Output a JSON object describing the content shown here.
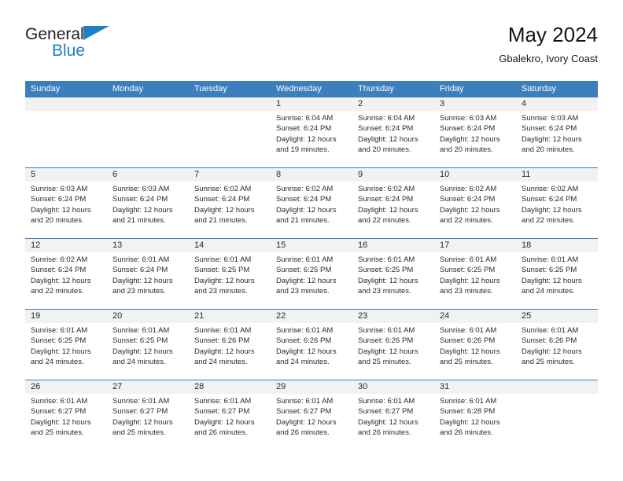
{
  "brand": {
    "name_part1": "General",
    "name_part2": "Blue",
    "logo_icon": "triangle-flag-icon",
    "color_dark": "#231f20",
    "color_blue": "#1f7fc4"
  },
  "header": {
    "title": "May 2024",
    "subtitle": "Gbalekro, Ivory Coast"
  },
  "theme": {
    "header_bg": "#3d7ebd",
    "day_band_bg": "#f2f2f2",
    "week_divider": "#3d7ebd"
  },
  "weekdays": [
    "Sunday",
    "Monday",
    "Tuesday",
    "Wednesday",
    "Thursday",
    "Friday",
    "Saturday"
  ],
  "weeks": [
    [
      {
        "day": "",
        "sunrise": "",
        "sunset": "",
        "daylight_line1": "",
        "daylight_line2": ""
      },
      {
        "day": "",
        "sunrise": "",
        "sunset": "",
        "daylight_line1": "",
        "daylight_line2": ""
      },
      {
        "day": "",
        "sunrise": "",
        "sunset": "",
        "daylight_line1": "",
        "daylight_line2": ""
      },
      {
        "day": "1",
        "sunrise": "Sunrise: 6:04 AM",
        "sunset": "Sunset: 6:24 PM",
        "daylight_line1": "Daylight: 12 hours",
        "daylight_line2": "and 19 minutes."
      },
      {
        "day": "2",
        "sunrise": "Sunrise: 6:04 AM",
        "sunset": "Sunset: 6:24 PM",
        "daylight_line1": "Daylight: 12 hours",
        "daylight_line2": "and 20 minutes."
      },
      {
        "day": "3",
        "sunrise": "Sunrise: 6:03 AM",
        "sunset": "Sunset: 6:24 PM",
        "daylight_line1": "Daylight: 12 hours",
        "daylight_line2": "and 20 minutes."
      },
      {
        "day": "4",
        "sunrise": "Sunrise: 6:03 AM",
        "sunset": "Sunset: 6:24 PM",
        "daylight_line1": "Daylight: 12 hours",
        "daylight_line2": "and 20 minutes."
      }
    ],
    [
      {
        "day": "5",
        "sunrise": "Sunrise: 6:03 AM",
        "sunset": "Sunset: 6:24 PM",
        "daylight_line1": "Daylight: 12 hours",
        "daylight_line2": "and 20 minutes."
      },
      {
        "day": "6",
        "sunrise": "Sunrise: 6:03 AM",
        "sunset": "Sunset: 6:24 PM",
        "daylight_line1": "Daylight: 12 hours",
        "daylight_line2": "and 21 minutes."
      },
      {
        "day": "7",
        "sunrise": "Sunrise: 6:02 AM",
        "sunset": "Sunset: 6:24 PM",
        "daylight_line1": "Daylight: 12 hours",
        "daylight_line2": "and 21 minutes."
      },
      {
        "day": "8",
        "sunrise": "Sunrise: 6:02 AM",
        "sunset": "Sunset: 6:24 PM",
        "daylight_line1": "Daylight: 12 hours",
        "daylight_line2": "and 21 minutes."
      },
      {
        "day": "9",
        "sunrise": "Sunrise: 6:02 AM",
        "sunset": "Sunset: 6:24 PM",
        "daylight_line1": "Daylight: 12 hours",
        "daylight_line2": "and 22 minutes."
      },
      {
        "day": "10",
        "sunrise": "Sunrise: 6:02 AM",
        "sunset": "Sunset: 6:24 PM",
        "daylight_line1": "Daylight: 12 hours",
        "daylight_line2": "and 22 minutes."
      },
      {
        "day": "11",
        "sunrise": "Sunrise: 6:02 AM",
        "sunset": "Sunset: 6:24 PM",
        "daylight_line1": "Daylight: 12 hours",
        "daylight_line2": "and 22 minutes."
      }
    ],
    [
      {
        "day": "12",
        "sunrise": "Sunrise: 6:02 AM",
        "sunset": "Sunset: 6:24 PM",
        "daylight_line1": "Daylight: 12 hours",
        "daylight_line2": "and 22 minutes."
      },
      {
        "day": "13",
        "sunrise": "Sunrise: 6:01 AM",
        "sunset": "Sunset: 6:24 PM",
        "daylight_line1": "Daylight: 12 hours",
        "daylight_line2": "and 23 minutes."
      },
      {
        "day": "14",
        "sunrise": "Sunrise: 6:01 AM",
        "sunset": "Sunset: 6:25 PM",
        "daylight_line1": "Daylight: 12 hours",
        "daylight_line2": "and 23 minutes."
      },
      {
        "day": "15",
        "sunrise": "Sunrise: 6:01 AM",
        "sunset": "Sunset: 6:25 PM",
        "daylight_line1": "Daylight: 12 hours",
        "daylight_line2": "and 23 minutes."
      },
      {
        "day": "16",
        "sunrise": "Sunrise: 6:01 AM",
        "sunset": "Sunset: 6:25 PM",
        "daylight_line1": "Daylight: 12 hours",
        "daylight_line2": "and 23 minutes."
      },
      {
        "day": "17",
        "sunrise": "Sunrise: 6:01 AM",
        "sunset": "Sunset: 6:25 PM",
        "daylight_line1": "Daylight: 12 hours",
        "daylight_line2": "and 23 minutes."
      },
      {
        "day": "18",
        "sunrise": "Sunrise: 6:01 AM",
        "sunset": "Sunset: 6:25 PM",
        "daylight_line1": "Daylight: 12 hours",
        "daylight_line2": "and 24 minutes."
      }
    ],
    [
      {
        "day": "19",
        "sunrise": "Sunrise: 6:01 AM",
        "sunset": "Sunset: 6:25 PM",
        "daylight_line1": "Daylight: 12 hours",
        "daylight_line2": "and 24 minutes."
      },
      {
        "day": "20",
        "sunrise": "Sunrise: 6:01 AM",
        "sunset": "Sunset: 6:25 PM",
        "daylight_line1": "Daylight: 12 hours",
        "daylight_line2": "and 24 minutes."
      },
      {
        "day": "21",
        "sunrise": "Sunrise: 6:01 AM",
        "sunset": "Sunset: 6:26 PM",
        "daylight_line1": "Daylight: 12 hours",
        "daylight_line2": "and 24 minutes."
      },
      {
        "day": "22",
        "sunrise": "Sunrise: 6:01 AM",
        "sunset": "Sunset: 6:26 PM",
        "daylight_line1": "Daylight: 12 hours",
        "daylight_line2": "and 24 minutes."
      },
      {
        "day": "23",
        "sunrise": "Sunrise: 6:01 AM",
        "sunset": "Sunset: 6:26 PM",
        "daylight_line1": "Daylight: 12 hours",
        "daylight_line2": "and 25 minutes."
      },
      {
        "day": "24",
        "sunrise": "Sunrise: 6:01 AM",
        "sunset": "Sunset: 6:26 PM",
        "daylight_line1": "Daylight: 12 hours",
        "daylight_line2": "and 25 minutes."
      },
      {
        "day": "25",
        "sunrise": "Sunrise: 6:01 AM",
        "sunset": "Sunset: 6:26 PM",
        "daylight_line1": "Daylight: 12 hours",
        "daylight_line2": "and 25 minutes."
      }
    ],
    [
      {
        "day": "26",
        "sunrise": "Sunrise: 6:01 AM",
        "sunset": "Sunset: 6:27 PM",
        "daylight_line1": "Daylight: 12 hours",
        "daylight_line2": "and 25 minutes."
      },
      {
        "day": "27",
        "sunrise": "Sunrise: 6:01 AM",
        "sunset": "Sunset: 6:27 PM",
        "daylight_line1": "Daylight: 12 hours",
        "daylight_line2": "and 25 minutes."
      },
      {
        "day": "28",
        "sunrise": "Sunrise: 6:01 AM",
        "sunset": "Sunset: 6:27 PM",
        "daylight_line1": "Daylight: 12 hours",
        "daylight_line2": "and 26 minutes."
      },
      {
        "day": "29",
        "sunrise": "Sunrise: 6:01 AM",
        "sunset": "Sunset: 6:27 PM",
        "daylight_line1": "Daylight: 12 hours",
        "daylight_line2": "and 26 minutes."
      },
      {
        "day": "30",
        "sunrise": "Sunrise: 6:01 AM",
        "sunset": "Sunset: 6:27 PM",
        "daylight_line1": "Daylight: 12 hours",
        "daylight_line2": "and 26 minutes."
      },
      {
        "day": "31",
        "sunrise": "Sunrise: 6:01 AM",
        "sunset": "Sunset: 6:28 PM",
        "daylight_line1": "Daylight: 12 hours",
        "daylight_line2": "and 26 minutes."
      },
      {
        "day": "",
        "sunrise": "",
        "sunset": "",
        "daylight_line1": "",
        "daylight_line2": ""
      }
    ]
  ]
}
